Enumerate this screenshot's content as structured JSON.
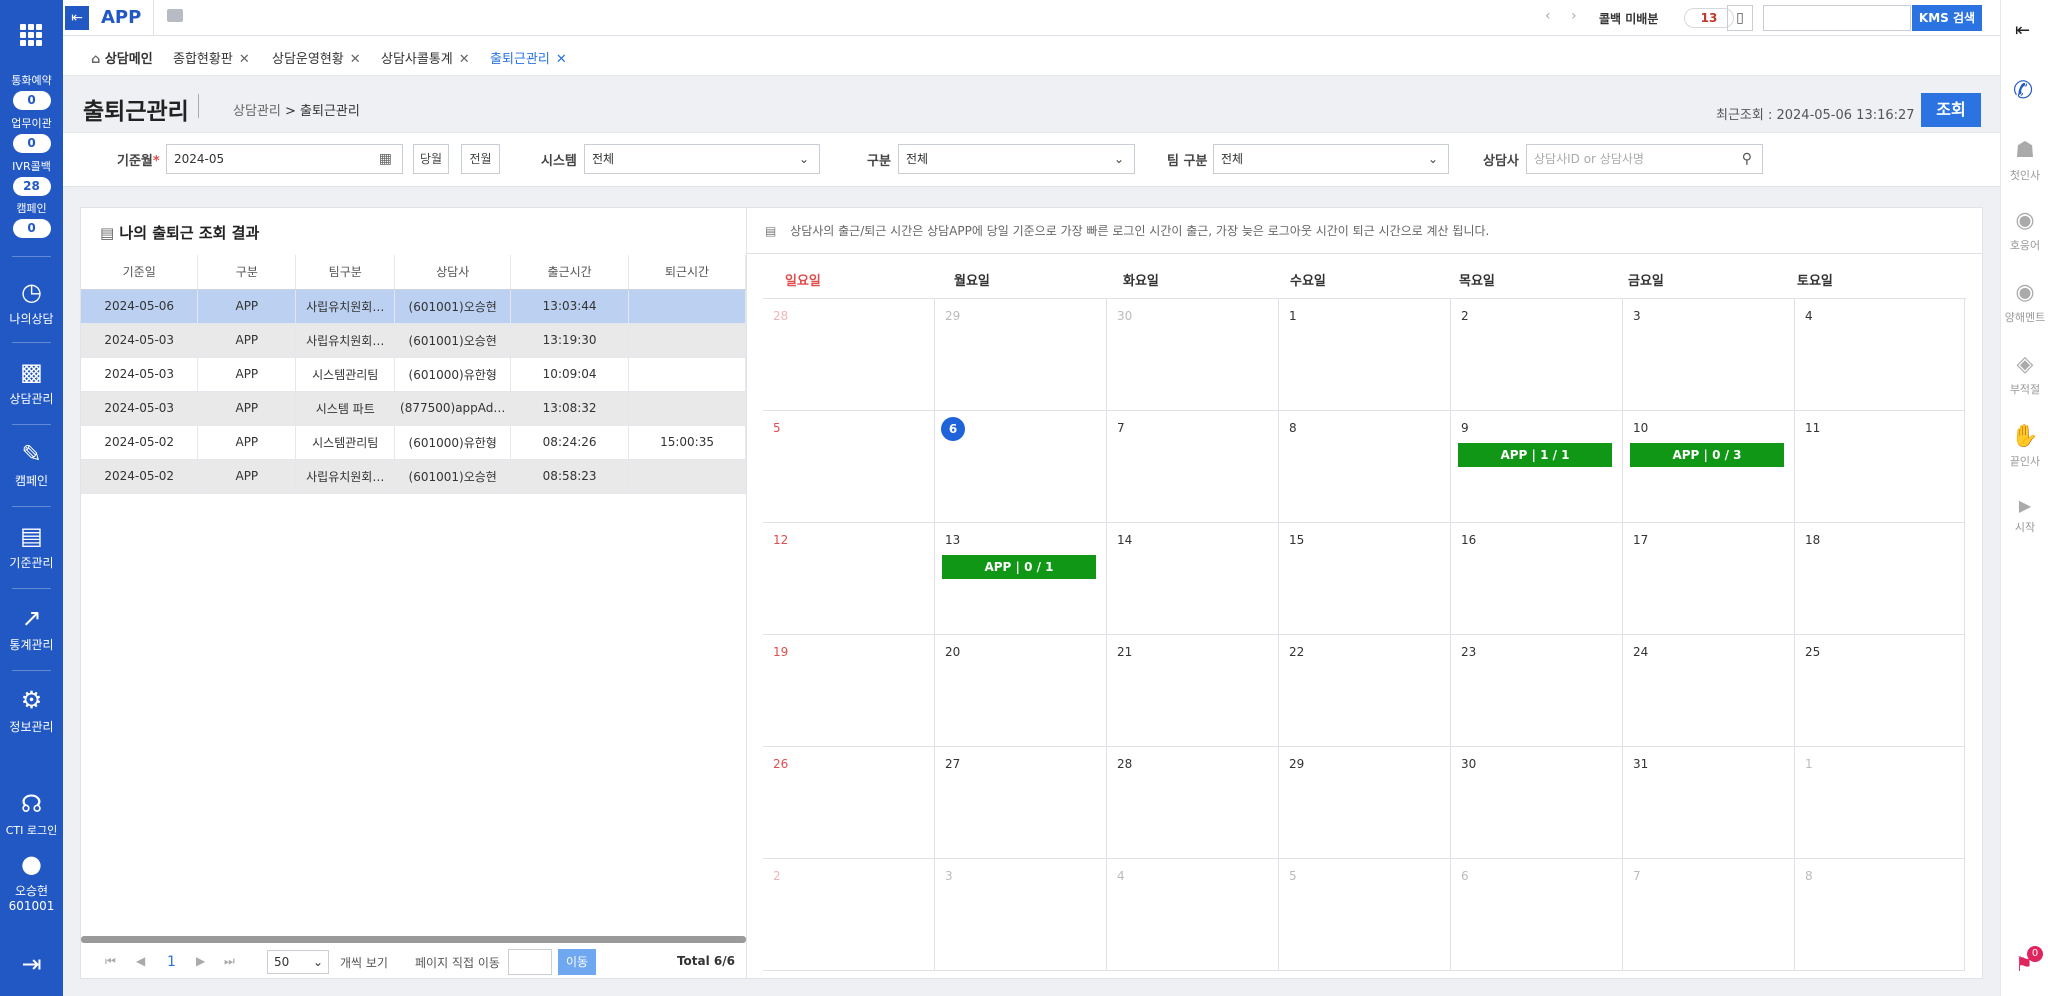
{
  "app": {
    "name": "APP"
  },
  "top": {
    "callback_label": "콜백 미배분",
    "callback_count": "13",
    "kms_button": "KMS 검색",
    "search_value": ""
  },
  "tabs": [
    {
      "label": "상담메인",
      "closable": false
    },
    {
      "label": "종합현황판",
      "closable": true
    },
    {
      "label": "상담운영현황",
      "closable": true
    },
    {
      "label": "상담사콜통계",
      "closable": true
    },
    {
      "label": "출퇴근관리",
      "closable": true,
      "active": true
    }
  ],
  "left": {
    "counters": [
      {
        "label": "통화예약",
        "value": "0"
      },
      {
        "label": "업무이관",
        "value": "0"
      },
      {
        "label": "IVR콜백",
        "value": "28"
      },
      {
        "label": "캠페인",
        "value": "0"
      }
    ],
    "nav": [
      "나의상담",
      "상담관리",
      "캠페인",
      "기준관리",
      "통계관리",
      "정보관리"
    ],
    "cti": "CTI 로그인",
    "user_name": "오승현",
    "user_id": "601001"
  },
  "right": {
    "items": [
      "첫인사",
      "호응어",
      "양해멘트",
      "부적절",
      "끝인사",
      "시작"
    ],
    "bell_count": "0"
  },
  "page": {
    "title": "출퇴근관리",
    "crumb_parent": "상담관리",
    "crumb_sep": ">",
    "crumb_current": "출퇴근관리",
    "last_query": "최근조회 : 2024-05-06 13:16:27",
    "query_button": "조회"
  },
  "filters": {
    "base_month_label": "기준월",
    "required_mark": "*",
    "base_month_value": "2024-05",
    "this_month": "당월",
    "prev_month": "전월",
    "system_label": "시스템",
    "system_value": "전체",
    "type_label": "구분",
    "type_value": "전체",
    "team_label": "팀 구분",
    "team_value": "전체",
    "agent_label": "상담사",
    "agent_placeholder": "상담사ID or 상담사명"
  },
  "result": {
    "title": "나의 출퇴근 조회 결과",
    "columns": [
      "기준일",
      "구분",
      "팀구분",
      "상담사",
      "출근시간",
      "퇴근시간"
    ],
    "rows": [
      [
        "2024-05-06",
        "APP",
        "사립유치원회…",
        "(601001)오승현",
        "13:03:44",
        ""
      ],
      [
        "2024-05-03",
        "APP",
        "사립유치원회…",
        "(601001)오승현",
        "13:19:30",
        ""
      ],
      [
        "2024-05-03",
        "APP",
        "시스템관리팀",
        "(601000)유한형",
        "10:09:04",
        ""
      ],
      [
        "2024-05-03",
        "APP",
        "시스템 파트",
        "(877500)appAd…",
        "13:08:32",
        ""
      ],
      [
        "2024-05-02",
        "APP",
        "시스템관리팀",
        "(601000)유한형",
        "08:24:26",
        "15:00:35"
      ],
      [
        "2024-05-02",
        "APP",
        "사립유치원회…",
        "(601001)오승현",
        "08:58:23",
        ""
      ]
    ],
    "pager": {
      "page": "1",
      "page_size": "50",
      "view_label": "개씩 보기",
      "jump_label": "페이지 직접 이동",
      "go_button": "이동",
      "total": "Total 6/6"
    }
  },
  "calendar": {
    "notice": "상담사의 출근/퇴근 시간은 상담APP에 당일 기준으로 가장 빠른 로그인 시간이 출근, 가장 늦은 로그아웃 시간이 퇴근 시간으로 계산 됩니다.",
    "weekdays": [
      "일요일",
      "월요일",
      "화요일",
      "수요일",
      "목요일",
      "금요일",
      "토요일"
    ],
    "weeks": [
      [
        "28",
        "29",
        "30",
        "1",
        "2",
        "3",
        "4"
      ],
      [
        "5",
        "6",
        "7",
        "8",
        "9",
        "10",
        "11"
      ],
      [
        "12",
        "13",
        "14",
        "15",
        "16",
        "17",
        "18"
      ],
      [
        "19",
        "20",
        "21",
        "22",
        "23",
        "24",
        "25"
      ],
      [
        "26",
        "27",
        "28",
        "29",
        "30",
        "31",
        "1"
      ],
      [
        "2",
        "3",
        "4",
        "5",
        "6",
        "7",
        "8"
      ]
    ],
    "events": {
      "1-4": "APP | 1 / 1",
      "1-5": "APP | 0 / 3",
      "2-1": "APP | 0 / 1"
    },
    "today": "6"
  },
  "colors": {
    "brand": "#2158c4",
    "event": "#0f9715",
    "today": "#1e63d9",
    "sunday": "#e04e4e"
  }
}
